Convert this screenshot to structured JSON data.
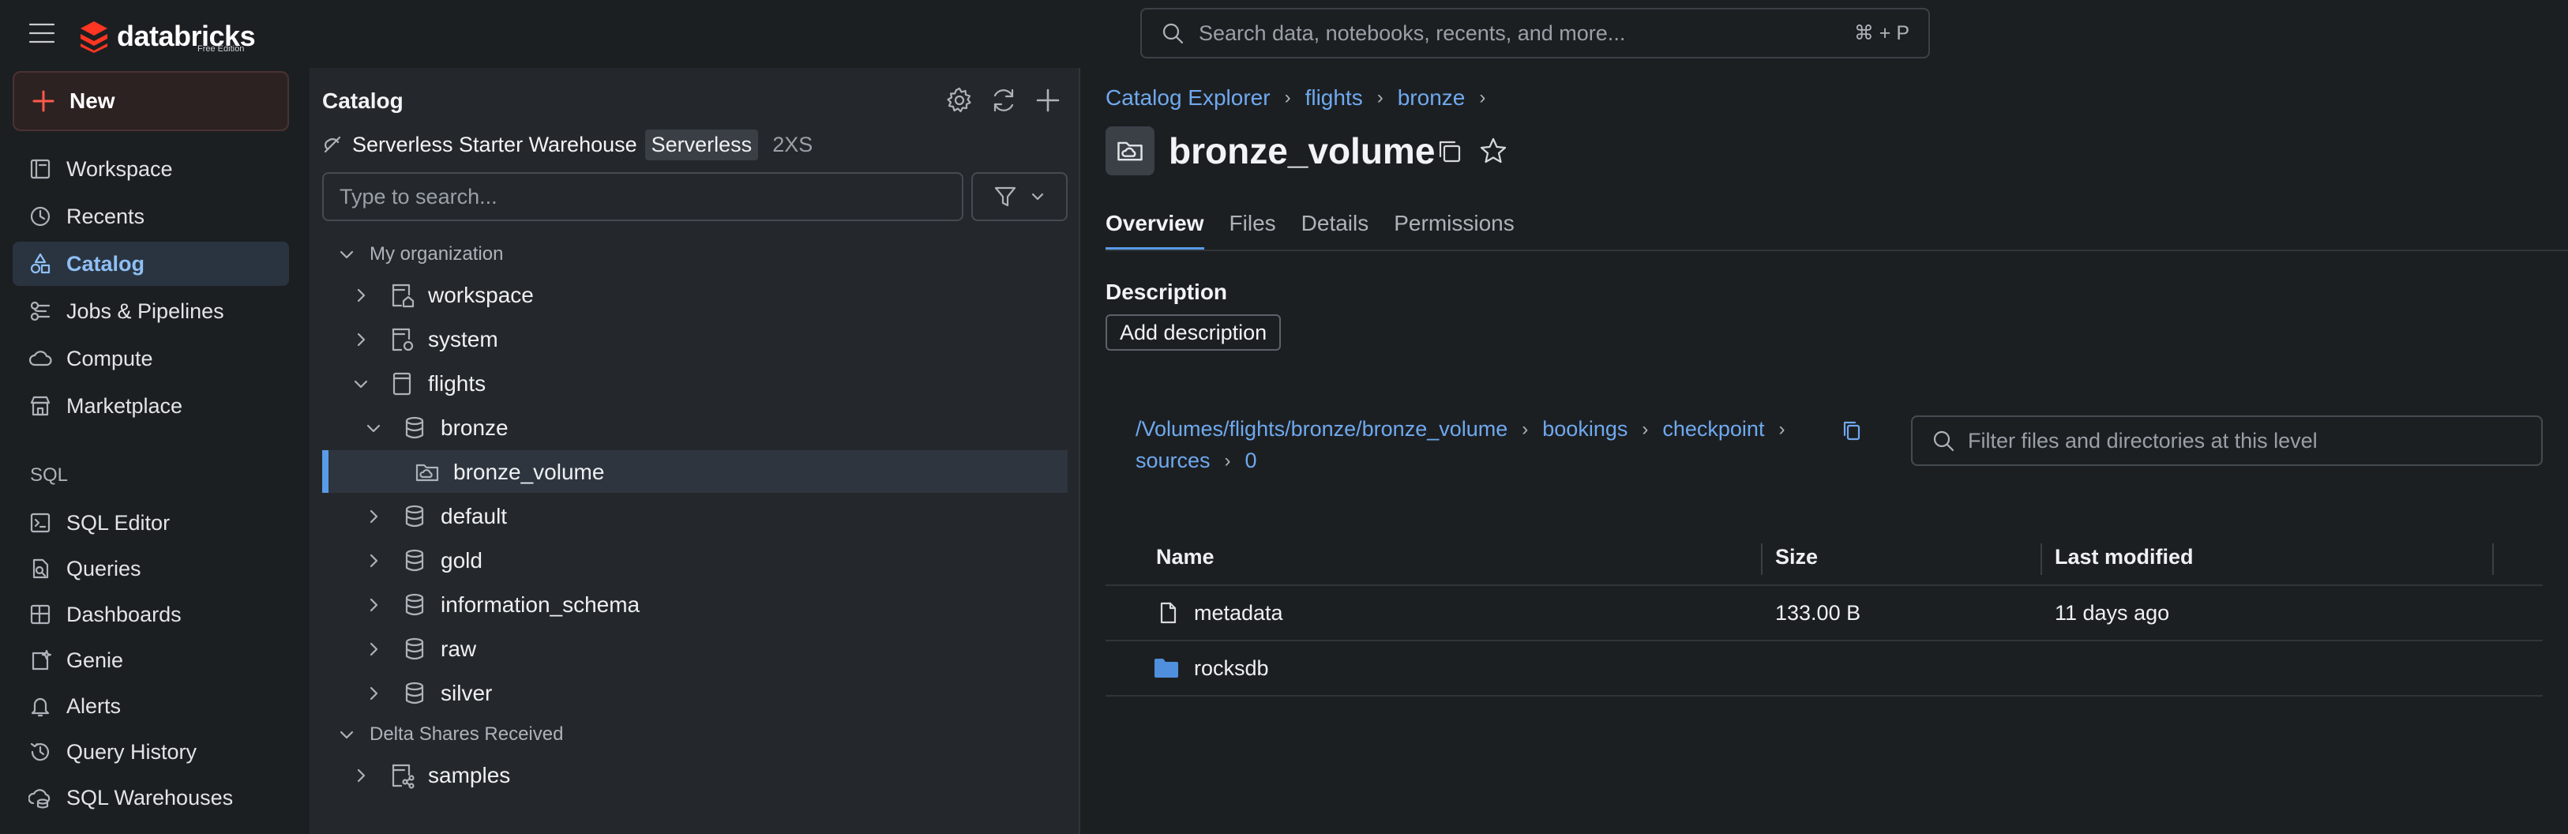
{
  "header": {
    "logo_text": "databricks",
    "logo_subtext": "Free Edition",
    "search_placeholder": "Search data, notebooks, recents, and more...",
    "search_shortcut": "⌘ + P"
  },
  "nav": {
    "new_label": "New",
    "items": [
      {
        "label": "Workspace"
      },
      {
        "label": "Recents"
      },
      {
        "label": "Catalog"
      },
      {
        "label": "Jobs & Pipelines"
      },
      {
        "label": "Compute"
      },
      {
        "label": "Marketplace"
      }
    ],
    "sql_heading": "SQL",
    "sql_items": [
      {
        "label": "SQL Editor"
      },
      {
        "label": "Queries"
      },
      {
        "label": "Dashboards"
      },
      {
        "label": "Genie"
      },
      {
        "label": "Alerts"
      },
      {
        "label": "Query History"
      },
      {
        "label": "SQL Warehouses"
      }
    ]
  },
  "catalog": {
    "title": "Catalog",
    "warehouse_name": "Serverless Starter Warehouse",
    "warehouse_type": "Serverless",
    "warehouse_size": "2XS",
    "search_placeholder": "Type to search...",
    "tree": {
      "my_org": "My organization",
      "workspace": "workspace",
      "system": "system",
      "flights": "flights",
      "bronze": "bronze",
      "bronze_volume": "bronze_volume",
      "default": "default",
      "gold": "gold",
      "information_schema": "information_schema",
      "raw": "raw",
      "silver": "silver",
      "delta_shares": "Delta Shares Received",
      "samples": "samples"
    }
  },
  "main": {
    "breadcrumbs": [
      "Catalog Explorer",
      "flights",
      "bronze"
    ],
    "title": "bronze_volume",
    "tabs": [
      "Overview",
      "Files",
      "Details",
      "Permissions"
    ],
    "description_heading": "Description",
    "add_description": "Add description",
    "path": {
      "root": "/Volumes/flights/bronze/bronze_volume",
      "seg1": "bookings",
      "seg2": "checkpoint",
      "seg3": "sources",
      "seg4": "0"
    },
    "file_filter_placeholder": "Filter files and directories at this level",
    "table": {
      "headers": [
        "Name",
        "Size",
        "Last modified"
      ],
      "rows": [
        {
          "name": "metadata",
          "size": "133.00 B",
          "modified": "11 days ago",
          "kind": "file-icon"
        },
        {
          "name": "rocksdb",
          "size": "",
          "modified": "",
          "kind": "folder-icon"
        }
      ]
    }
  },
  "colors": {
    "accent": "#5a9be8",
    "link": "#6fa9ef",
    "brand": "#ff3621"
  }
}
